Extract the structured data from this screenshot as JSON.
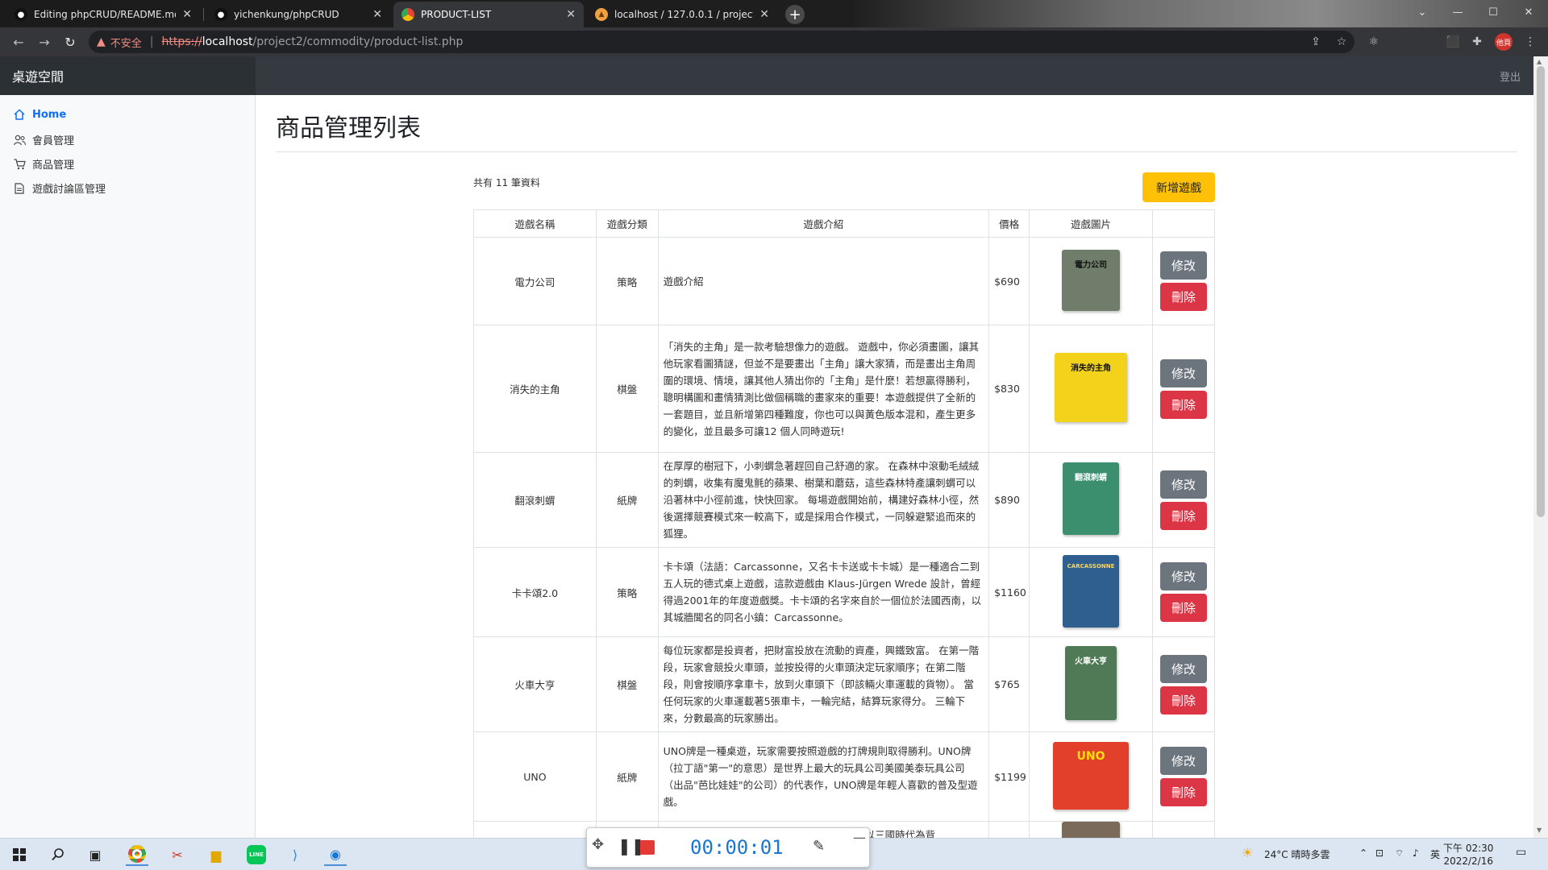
{
  "browser": {
    "tabs": [
      {
        "title": "Editing phpCRUD/README.md",
        "icon": "github-icon",
        "active": false
      },
      {
        "title": "yichenkung/phpCRUD",
        "icon": "github-icon",
        "active": false
      },
      {
        "title": "PRODUCT-LIST",
        "icon": "chrome-icon",
        "active": true
      },
      {
        "title": "localhost / 127.0.0.1 / project2",
        "icon": "phpmyadmin-icon",
        "active": false
      }
    ],
    "security_label": "不安全",
    "url_scheme": "https://",
    "url_host": "localhost",
    "url_path": "/project2/commodity/product-list.php",
    "profile_label": "他頁"
  },
  "app": {
    "brand": "桌遊空間",
    "logout": "登出"
  },
  "sidebar": {
    "items": [
      {
        "label": "Home",
        "icon": "home-icon",
        "active": true
      },
      {
        "label": "會員管理",
        "icon": "users-icon",
        "active": false
      },
      {
        "label": "商品管理",
        "icon": "cart-icon",
        "active": false
      },
      {
        "label": "遊戲討論區管理",
        "icon": "file-icon",
        "active": false
      }
    ]
  },
  "main": {
    "title": "商品管理列表",
    "count_text": "共有 11 筆資料",
    "add_button": "新增遊戲",
    "edit_label": "修改",
    "delete_label": "刪除",
    "columns": [
      "遊戲名稱",
      "遊戲分類",
      "遊戲介紹",
      "價格",
      "遊戲圖片",
      ""
    ],
    "rows": [
      {
        "name": "電力公司",
        "category": "策略",
        "intro": "遊戲介紹",
        "price": "$690",
        "img_color": "#6f7d6a",
        "img_label": "電力公司"
      },
      {
        "name": "消失的主角",
        "category": "棋盤",
        "intro": "「消失的主角」是一款考驗想像力的遊戲。 遊戲中，你必須畫圖，讓其他玩家看圖猜謎，但並不是要畫出「主角」讓大家猜，而是畫出主角周圍的環境、情境，讓其他人猜出你的「主角」是什麼！若想贏得勝利，聰明構圖和畫情猜測比做個稱職的畫家來的重要！本遊戲提供了全新的一套題目，並且新增第四種難度，你也可以與黃色版本混和，產生更多的變化，並且最多可讓12 個人同時遊玩!",
        "price": "$830",
        "img_color": "#f2d21b",
        "img_label": "消失的主角"
      },
      {
        "name": "翻滾刺蝟",
        "category": "紙牌",
        "intro": "在厚厚的樹冠下，小刺蝟急著趕回自己舒適的家。 在森林中滾動毛絨絨的刺蝟，收集有魔鬼氈的蘋果、樹葉和蘑菇，這些森林特產讓刺蝟可以沿著林中小徑前進，快快回家。 每場遊戲開始前，構建好森林小徑，然後選擇競賽模式來一較高下，或是採用合作模式，一同躲避緊追而來的狐狸。",
        "price": "$890",
        "img_color": "#3c8f6e",
        "img_label": "翻滾刺蝟"
      },
      {
        "name": "卡卡頌2.0",
        "category": "策略",
        "intro": "卡卡頌（法語：Carcassonne，又名卡卡送或卡卡城）是一種適合二到五人玩的德式桌上遊戲，這款遊戲由 Klaus-Jürgen Wrede 設計，曾經得過2001年的年度遊戲獎。卡卡頌的名字來自於一個位於法國西南，以其城牆聞名的同名小鎮：Carcassonne。",
        "price": "$1160",
        "img_color": "#2f5f8f",
        "img_label": "CARCASSONNE"
      },
      {
        "name": "火車大亨",
        "category": "棋盤",
        "intro": "每位玩家都是投資者，把財富投放在流動的資產，興鐵致富。 在第一階段，玩家會競投火車頭，並按投得的火車頭決定玩家順序；在第二階段，則會按順序拿車卡，放到火車頭下（即該輛火車運載的貨物）。 當任何玩家的火車運載著5張車卡，一輪完結，結算玩家得分。 三輪下來，分數最高的玩家勝出。",
        "price": "$765",
        "img_color": "#4f7a55",
        "img_label": "火車大亨"
      },
      {
        "name": "UNO",
        "category": "紙牌",
        "intro": "UNO牌是一種桌遊，玩家需要按照遊戲的打牌規則取得勝利。UNO牌（拉丁語\"第一\"的意思）是世界上最大的玩具公司美國美泰玩具公司（出品\"芭比娃娃\"的公司）的代表作，UNO牌是年輕人喜歡的普及型遊戲。",
        "price": "$1199",
        "img_color": "#e2402b",
        "img_label": "UNO"
      },
      {
        "name": "",
        "category": "",
        "intro": "揭牌三國是一個吸牌牌系遊戲，玩家扮演一個以三國時代為背",
        "price": "",
        "img_color": "#7a6a5a",
        "img_label": ""
      }
    ]
  },
  "taskbar": {
    "weather": "24°C  晴時多雲",
    "ime": "英",
    "time": "下午 02:30",
    "date": "2022/2/16"
  },
  "recorder": {
    "elapsed": "00:00:01"
  }
}
